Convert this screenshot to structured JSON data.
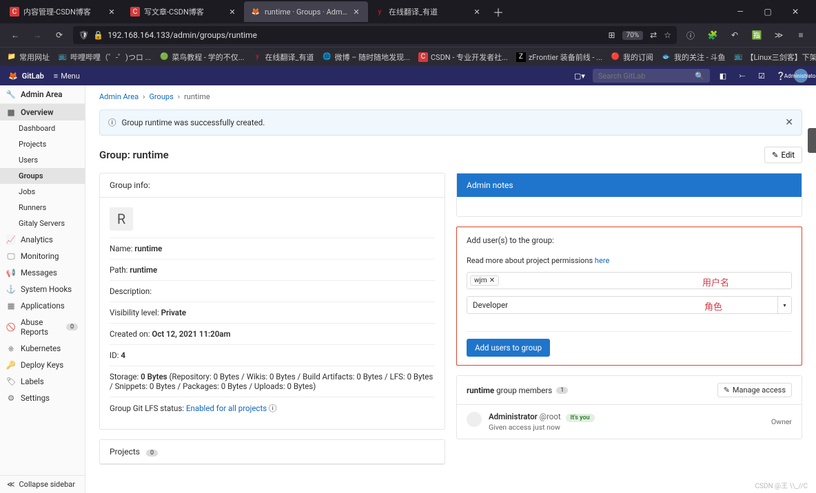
{
  "browser": {
    "tabs": [
      {
        "icon": "C",
        "iconBg": "#d63a3a",
        "title": "内容管理-CSDN博客"
      },
      {
        "icon": "C",
        "iconBg": "#d63a3a",
        "title": "写文章-CSDN博客"
      },
      {
        "icon": "🦊",
        "iconBg": "",
        "title": "runtime · Groups · Admin Are",
        "active": true
      },
      {
        "icon": "y",
        "iconBg": "#c23",
        "title": "在线翻译_有道"
      }
    ],
    "url": "192.168.164.133/admin/groups/runtime",
    "zoom": "70%",
    "bookmarks": [
      {
        "icon": "📁",
        "label": "常用网址"
      },
      {
        "icon": "🔵",
        "label": "哔哩哔哩（゜-゜)つロ ..."
      },
      {
        "icon": "🟢",
        "label": "菜鸟教程 - 学的不仅..."
      },
      {
        "icon": "y",
        "label": "在线翻译_有道"
      },
      {
        "icon": "🌐",
        "label": "微博 – 随时随地发现..."
      },
      {
        "icon": "C",
        "label": "CSDN - 专业开发者社..."
      },
      {
        "icon": "Z",
        "label": "zFrontier 装备前线 - ..."
      },
      {
        "icon": "🔴",
        "label": "我的订阅"
      },
      {
        "icon": "🐟",
        "label": "我的关注 - 斗鱼"
      },
      {
        "icon": "📺",
        "label": "【Linux三剑客】下架..."
      }
    ]
  },
  "gitlab": {
    "brand": "GitLab",
    "menu": "Menu",
    "search_placeholder": "Search GitLab",
    "user_badge": "Administrator"
  },
  "sidebar": {
    "title": "Admin Area",
    "overview": "Overview",
    "sub": [
      "Dashboard",
      "Projects",
      "Users",
      "Groups",
      "Jobs",
      "Runners",
      "Gitaly Servers"
    ],
    "items": [
      {
        "label": "Analytics"
      },
      {
        "label": "Monitoring"
      },
      {
        "label": "Messages"
      },
      {
        "label": "System Hooks"
      },
      {
        "label": "Applications"
      },
      {
        "label": "Abuse Reports",
        "badge": "0"
      },
      {
        "label": "Kubernetes"
      },
      {
        "label": "Deploy Keys"
      },
      {
        "label": "Labels"
      },
      {
        "label": "Settings"
      }
    ],
    "collapse": "Collapse sidebar"
  },
  "breadcrumb": [
    "Admin Area",
    "Groups",
    "runtime"
  ],
  "alert": "Group runtime was successfully created.",
  "page": {
    "title": "Group: runtime",
    "edit": "Edit"
  },
  "group_info": {
    "header": "Group info:",
    "avatar": "R",
    "name_label": "Name:",
    "name": "runtime",
    "path_label": "Path:",
    "path": "runtime",
    "desc_label": "Description:",
    "vis_label": "Visibility level:",
    "vis": "Private",
    "created_label": "Created on:",
    "created": "Oct 12, 2021 11:20am",
    "id_label": "ID:",
    "id": "4",
    "storage_label": "Storage:",
    "storage_val": "0 Bytes",
    "storage_detail": "(Repository: 0 Bytes / Wikis: 0 Bytes / Build Artifacts: 0 Bytes / LFS: 0 Bytes / Snippets: 0 Bytes / Packages: 0 Bytes / Uploads: 0 Bytes)",
    "lfs_label": "Group Git LFS status:",
    "lfs_val": "Enabled for all projects"
  },
  "projects_panel": {
    "label": "Projects",
    "count": "0"
  },
  "admin_notes": {
    "header": "Admin notes"
  },
  "add_users": {
    "title": "Add user(s) to the group:",
    "hint_pre": "Read more about project permissions ",
    "hint_link": "here",
    "chip": "wjm",
    "role": "Developer",
    "button": "Add users to group",
    "anno_user": "用户名",
    "anno_role": "角色"
  },
  "members": {
    "title_pre": "runtime",
    "title_post": "group members",
    "count": "1",
    "manage": "Manage access",
    "admin_name": "Administrator",
    "admin_handle": "@root",
    "you": "It's you",
    "meta": "Given access just now",
    "role": "Owner"
  },
  "watermark": "CSDN @王 \\\\_//C"
}
